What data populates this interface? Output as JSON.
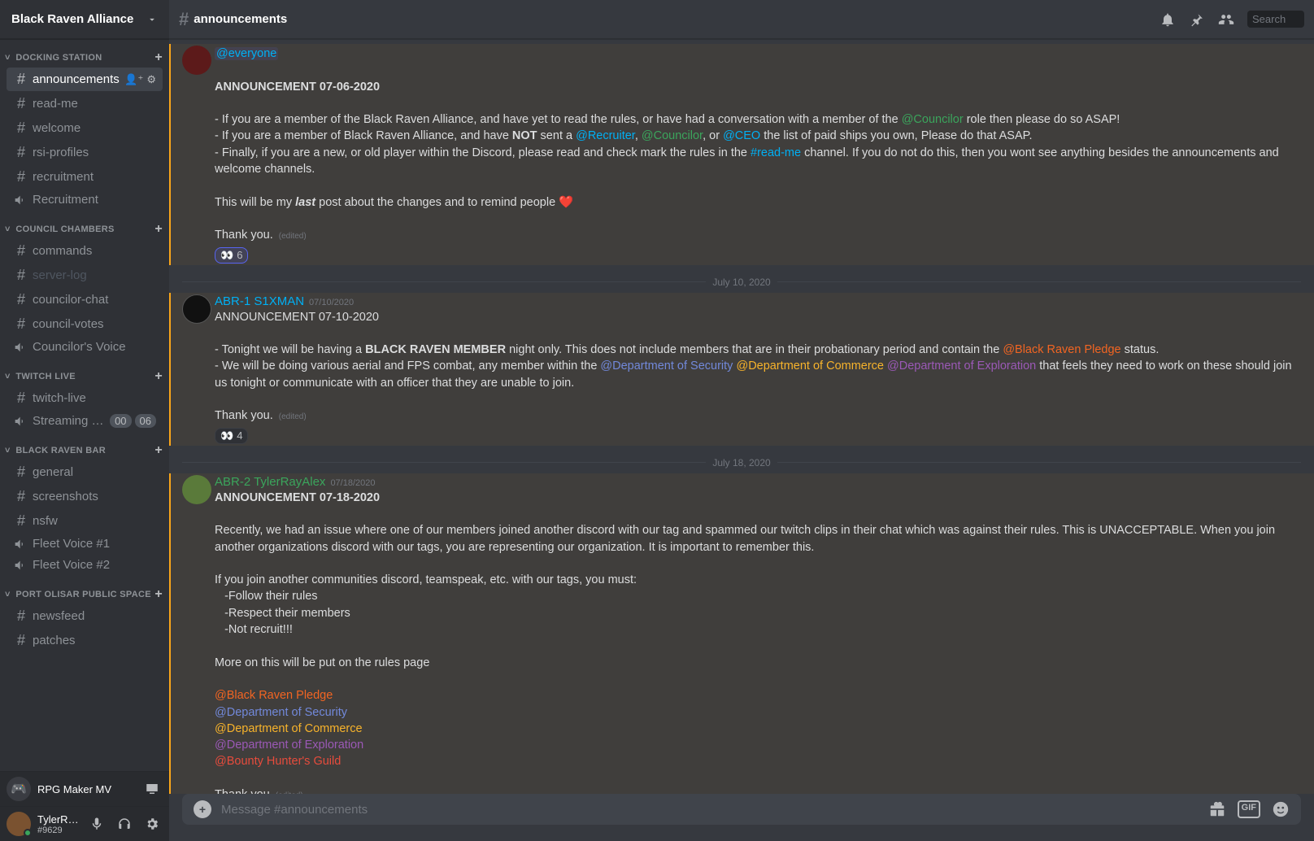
{
  "server": {
    "name": "Black Raven Alliance"
  },
  "top": {
    "channel": "announcements",
    "search_placeholder": "Search"
  },
  "categories": [
    {
      "name": "DOCKING STATION",
      "channels": [
        {
          "type": "text",
          "name": "announcements",
          "selected": true,
          "icons": [
            "user+",
            "gear"
          ]
        },
        {
          "type": "text",
          "name": "read-me"
        },
        {
          "type": "text",
          "name": "welcome"
        },
        {
          "type": "text",
          "name": "rsi-profiles"
        },
        {
          "type": "text",
          "name": "recruitment"
        },
        {
          "type": "voice",
          "name": "Recruitment"
        }
      ]
    },
    {
      "name": "COUNCIL CHAMBERS",
      "channels": [
        {
          "type": "text",
          "name": "commands"
        },
        {
          "type": "text",
          "name": "server-log",
          "muted": true
        },
        {
          "type": "text",
          "name": "councilor-chat"
        },
        {
          "type": "text",
          "name": "council-votes"
        },
        {
          "type": "voice",
          "name": "Councilor's Voice"
        }
      ]
    },
    {
      "name": "TWITCH LIVE",
      "channels": [
        {
          "type": "text",
          "name": "twitch-live"
        },
        {
          "type": "voice",
          "name": "Streaming - [DND]",
          "badges": [
            "00",
            "06"
          ]
        }
      ]
    },
    {
      "name": "BLACK RAVEN BAR",
      "channels": [
        {
          "type": "text",
          "name": "general"
        },
        {
          "type": "text",
          "name": "screenshots"
        },
        {
          "type": "text",
          "name": "nsfw"
        },
        {
          "type": "voice",
          "name": "Fleet Voice #1"
        },
        {
          "type": "voice",
          "name": "Fleet Voice #2"
        }
      ]
    },
    {
      "name": "PORT OLISAR PUBLIC SPACE",
      "channels": [
        {
          "type": "text",
          "name": "newsfeed"
        },
        {
          "type": "text",
          "name": "patches"
        }
      ]
    }
  ],
  "rich_presence": {
    "name": "RPG Maker MV"
  },
  "user": {
    "name": "TylerRayAlex",
    "discriminator": "#9629"
  },
  "input_placeholder": "Message #announcements",
  "colors": {
    "green": "#3ba55c",
    "blue": "#00b0f4",
    "orange": "#f26522",
    "yellow": "#f7b32b",
    "purple": "#9b59b6",
    "red": "#e74c3c",
    "link": "#00b0f4"
  },
  "messages": [
    {
      "mention_everyone": "@everyone",
      "title": "ANNOUNCEMENT 07-06-2020",
      "lines": [
        "- If you are a member of the Black Raven Alliance, and have yet to read the rules, or have had a conversation with a member of the ",
        "@Councilor",
        " role then please do so ASAP!",
        "- If you are a member of Black Raven Alliance, and have ",
        "NOT",
        " sent a ",
        "@Recruiter",
        ", ",
        "@Councilor",
        ", or ",
        "@CEO",
        " the list of paid ships you own, Please do that ASAP.",
        "- Finally, if you are a new, or old player within the Discord, please read and check mark the rules in the ",
        "#read-me",
        " channel. If you do not do this, then you wont see anything besides the announcements and welcome channels."
      ],
      "last_line": [
        "This will be my ",
        "last",
        " post about the changes and to remind people ❤️"
      ],
      "thanks": "Thank you.",
      "edited": "(edited)",
      "reaction": {
        "emoji": "👀",
        "count": "6"
      }
    },
    {
      "date": "July 10, 2020"
    },
    {
      "author": "ABR-1 S1XMAN",
      "author_color": "#00b0f4",
      "timestamp": "07/10/2020",
      "title": "ANNOUNCEMENT 07-10-2020",
      "p1": [
        "- Tonight we will be having a ",
        "BLACK RAVEN MEMBER",
        " night only. This does not include members that are in their probationary period and contain the ",
        "@Black Raven Pledge",
        " status."
      ],
      "p2": [
        "- We will be doing various aerial and FPS combat, any member within the ",
        "@Department of Security",
        " ",
        "@Department of Commerce",
        " ",
        "@Department of Exploration",
        " that feels they need to work on these should join us tonight or communicate with an officer that they are unable to join."
      ],
      "thanks": "Thank you.",
      "edited": "(edited)",
      "reaction": {
        "emoji": "👀",
        "count": "4"
      }
    },
    {
      "date": "July 18, 2020"
    },
    {
      "author": "ABR-2 TylerRayAlex",
      "author_color": "#3ba55c",
      "timestamp": "07/18/2020",
      "title": "ANNOUNCEMENT 07-18-2020",
      "p1": "Recently, we had an issue where one of our members joined another discord with our tag and spammed our twitch clips in their chat which was against their rules. This is UNACCEPTABLE. When you join another organizations discord with our tags, you are representing our organization. It is important to remember this.",
      "p2": "If you join another communities discord, teamspeak, etc. with our tags, you must:",
      "bullets": [
        "-Follow their rules",
        "-Respect their members",
        "-Not recruit!!!"
      ],
      "p3": "More on this will be put on the rules page",
      "roles": [
        {
          "text": "@Black Raven Pledge",
          "cls": "role-orange"
        },
        {
          "text": "@Department of Security",
          "cls": "role-lblue"
        },
        {
          "text": "@Department of Commerce",
          "cls": "role-yellow"
        },
        {
          "text": "@Department of Exploration",
          "cls": "role-purple"
        },
        {
          "text": "@Bounty Hunter's Guild",
          "cls": "role-red"
        }
      ],
      "thanks": "Thank you",
      "edited": "(edited)"
    }
  ]
}
